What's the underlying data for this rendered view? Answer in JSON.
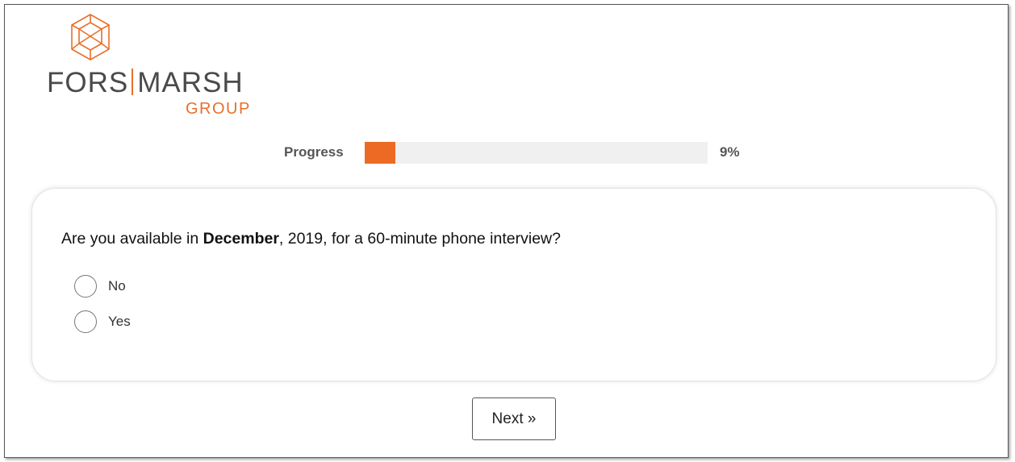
{
  "brand": {
    "logo_icon": "cube-icon",
    "name_left": "FORS",
    "name_right": "MARSH",
    "name_sub": "GROUP",
    "accent_color": "#ec6a24",
    "text_color": "#4a4a4a"
  },
  "progress": {
    "label": "Progress",
    "value_text": "9%",
    "fraction": 0.09
  },
  "question": {
    "text_before": "Are you available in ",
    "text_bold": "December",
    "text_after": ", 2019, for a 60-minute phone interview?",
    "options": [
      {
        "label": "No",
        "selected": false
      },
      {
        "label": "Yes",
        "selected": false
      }
    ]
  },
  "navigation": {
    "next_label": "Next »"
  }
}
